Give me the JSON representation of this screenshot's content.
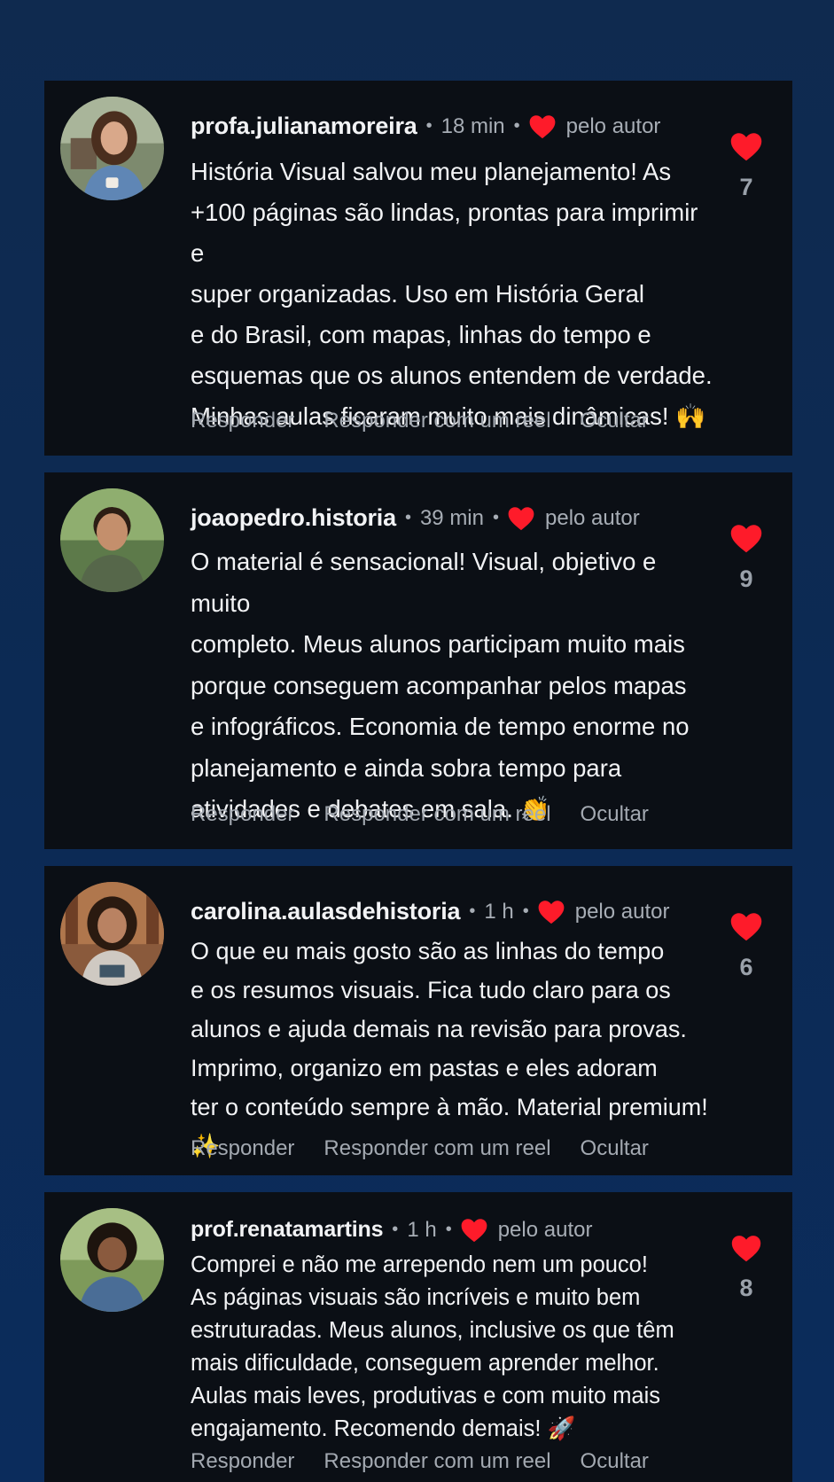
{
  "colors": {
    "heart": "#fe1b2a",
    "card_bg": "#0b0f15",
    "page_bg": "#0c2a54"
  },
  "icons": {
    "like": "heart-icon",
    "author_like": "heart-icon"
  },
  "comments": [
    {
      "username": "profa.julianamoreira",
      "time": "18 min",
      "author_like": "pelo autor",
      "text": "História Visual salvou meu planejamento! As\n+100 páginas são lindas, prontas para imprimir e\nsuper organizadas. Uso em História Geral\ne do Brasil, com mapas, linhas do tempo e\nesquemas que os alunos entendem de verdade.\nMinhas aulas ficaram muito mais dinâmicas! 🙌",
      "actions": [
        "Responder",
        "Responder com um reel",
        "Ocultar"
      ],
      "likes": "7"
    },
    {
      "username": "joaopedro.historia",
      "time": "39 min",
      "author_like": "pelo autor",
      "text": "O material é sensacional! Visual, objetivo e muito\ncompleto. Meus alunos participam muito mais\nporque conseguem acompanhar pelos mapas\ne infográficos. Economia de tempo enorme no\nplanejamento e ainda sobra tempo para\natividades e debates em sala. 👏",
      "actions": [
        "Responder",
        "Responder com um reel",
        "Ocultar"
      ],
      "likes": "9"
    },
    {
      "username": "carolina.aulasdehistoria",
      "time": "1 h",
      "author_like": "pelo autor",
      "text": "O que eu mais gosto são as linhas do tempo\ne os resumos visuais. Fica tudo claro para os\nalunos e ajuda demais na revisão para provas.\nImprimo, organizo em pastas e eles adoram\nter o conteúdo sempre à mão. Material premium! ✨",
      "actions": [
        "Responder",
        "Responder com um reel",
        "Ocultar"
      ],
      "likes": "6"
    },
    {
      "username": "prof.renatamartins",
      "time": "1 h",
      "author_like": "pelo autor",
      "text": "Comprei e não me arrependo nem um pouco!\nAs páginas visuais são incríveis e muito bem\nestruturadas. Meus alunos, inclusive os que têm\nmais dificuldade, conseguem aprender melhor.\nAulas mais leves, produtivas e com muito mais\nengajamento. Recomendo demais! 🚀",
      "actions": [
        "Responder",
        "Responder com um reel",
        "Ocultar"
      ],
      "likes": "8"
    }
  ]
}
